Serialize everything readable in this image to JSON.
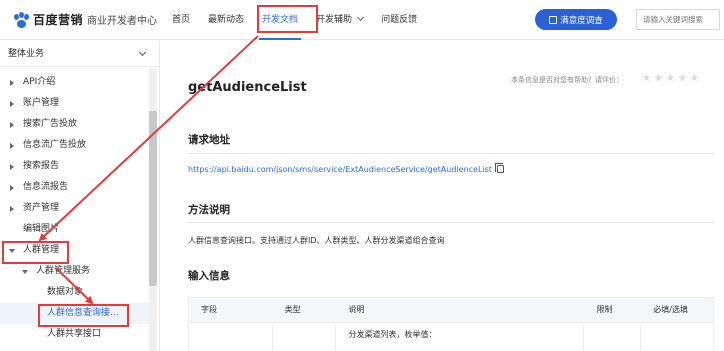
{
  "header": {
    "logo_text": "百度营销",
    "logo_sub": "商业开发者中心",
    "nav": [
      {
        "label": "首页"
      },
      {
        "label": "最新动态"
      },
      {
        "label": "开发文档"
      },
      {
        "label": "开发辅助"
      },
      {
        "label": "问题反馈"
      }
    ],
    "survey_label": "满意度调查",
    "search_placeholder": "请输入关键词搜索"
  },
  "sidebar": {
    "title": "整体业务",
    "items": [
      {
        "label": "API介绍"
      },
      {
        "label": "账户管理"
      },
      {
        "label": "搜索广告投放"
      },
      {
        "label": "信息流广告投放"
      },
      {
        "label": "搜索报告"
      },
      {
        "label": "信息流报告"
      },
      {
        "label": "资产管理"
      },
      {
        "label": "编辑图片"
      },
      {
        "label": "人群管理"
      },
      {
        "label": "人群管理服务"
      },
      {
        "label": "数据对象"
      },
      {
        "label": "人群信息查询接..."
      },
      {
        "label": "人群共享接口"
      }
    ]
  },
  "doc": {
    "title": "getAudienceList",
    "helpful": "本条信息是否对您有帮助？请评价：",
    "stars": "★★★★★",
    "sec_request": "请求地址",
    "url": "https://api.baidu.com/json/sms/service/ExtAudienceService/getAudienceList",
    "sec_method": "方法说明",
    "method_desc": "人群信息查询接口。支持通过人群ID、人群类型、人群分发渠道组合查询",
    "sec_input": "输入信息",
    "table": {
      "headers": [
        "字段",
        "类型",
        "说明",
        "限制",
        "必填/选填"
      ],
      "row1_desc": "分发渠道列表，枚举值："
    }
  },
  "colors": {
    "accent": "#2d6cdf",
    "annotation_red": "#e23b3b"
  }
}
